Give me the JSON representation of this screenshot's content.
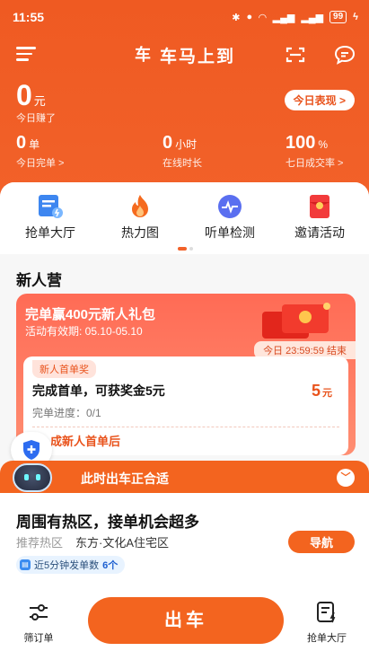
{
  "status_bar": {
    "time": "11:55",
    "battery": "99"
  },
  "header": {
    "app_name": "车马上到",
    "brand_logo_text": "车",
    "earnings": {
      "amount": "0",
      "unit": "元",
      "label": "今日赚了"
    },
    "performance_button": "今日表现 >",
    "stats": [
      {
        "value": "0",
        "unit": "单",
        "label": "今日完单 >"
      },
      {
        "value": "0",
        "unit": "小时",
        "label": "在线时长"
      },
      {
        "value": "100",
        "unit": "%",
        "label": "七日成交率 >"
      }
    ]
  },
  "quick_actions": [
    {
      "label": "抢单大厅",
      "icon": "order-hall-icon"
    },
    {
      "label": "热力图",
      "icon": "flame-icon"
    },
    {
      "label": "听单检测",
      "icon": "pulse-icon"
    },
    {
      "label": "邀请活动",
      "icon": "red-envelope-icon"
    }
  ],
  "newbie": {
    "section_title": "新人营",
    "promo_title": "完单赢400元新人礼包",
    "promo_period": "活动有效期: 05.10-05.10",
    "countdown": "今日 23:59:59 结束",
    "task_badge": "新人首单奖",
    "task_title": "完成首单，可获奖金5元",
    "reward_value": "5",
    "reward_unit": "元",
    "progress": "完单进度：0/1",
    "complete_hint": "成新人首单后"
  },
  "banner": {
    "text": "此时出车正合适"
  },
  "hot_area": {
    "title": "周围有热区，接单机会超多",
    "label": "推荐热区",
    "zone": "东方·文化A住宅区",
    "nav_button": "导航",
    "orders_text_prefix": "近5分钟发单数",
    "orders_count": "6个"
  },
  "footer": {
    "filter_label": "筛订单",
    "go_button": "出车",
    "hall_label": "抢单大厅"
  },
  "colors": {
    "brand": "#f2622a",
    "accent_blue": "#1d5fd0"
  }
}
